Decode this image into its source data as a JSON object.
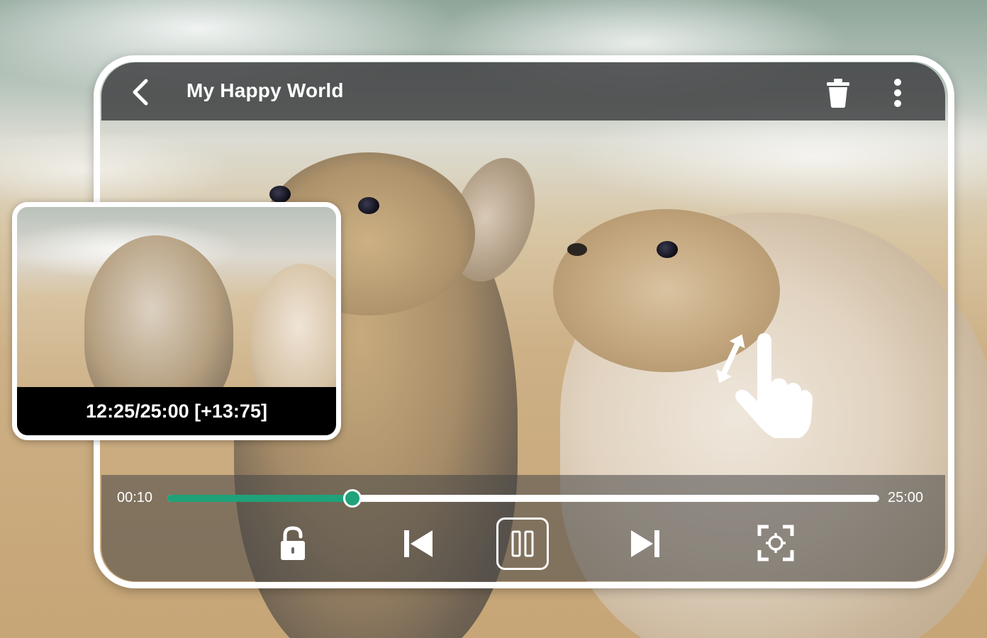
{
  "header": {
    "title": "My Happy World",
    "back_icon": "chevron-left-icon",
    "delete_icon": "trash-icon",
    "more_icon": "more-vertical-icon"
  },
  "preview": {
    "caption": "12:25/25:00 [+13:75]"
  },
  "gesture": {
    "icon": "swipe-vertical-hand-icon"
  },
  "player": {
    "current_time": "00:10",
    "total_time": "25:00",
    "progress": 0.26,
    "accent_color": "#1fa27a",
    "controls": {
      "lock_icon": "unlock-icon",
      "previous_icon": "skip-previous-icon",
      "pause_icon": "pause-icon",
      "next_icon": "skip-next-icon",
      "fullscreen_icon": "fullscreen-focus-icon"
    }
  }
}
